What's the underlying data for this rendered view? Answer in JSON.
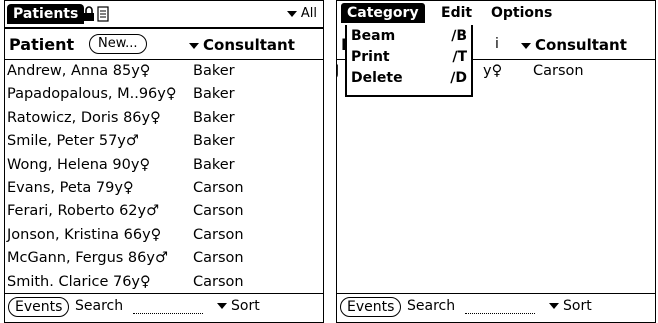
{
  "left": {
    "title": "Patients",
    "filter": "All",
    "patient_col": "Patient",
    "new_button": "New...",
    "consultant_col": "Consultant",
    "patients": [
      {
        "name": "Andrew, Anna 85y♀",
        "consultant": "Baker"
      },
      {
        "name": "Papadopalous, M..96y♀",
        "consultant": "Baker"
      },
      {
        "name": "Ratowicz, Doris 86y♀",
        "consultant": "Baker"
      },
      {
        "name": "Smile, Peter 57y♂",
        "consultant": "Baker"
      },
      {
        "name": "Wong, Helena 90y♀",
        "consultant": "Baker"
      },
      {
        "name": "Evans, Peta 79y♀",
        "consultant": "Carson"
      },
      {
        "name": "Ferari, Roberto 62y♂",
        "consultant": "Carson"
      },
      {
        "name": "Jonson, Kristina 66y♀",
        "consultant": "Carson"
      },
      {
        "name": "McGann, Fergus 86y♂",
        "consultant": "Carson"
      },
      {
        "name": "Smith. Clarice 76y♀",
        "consultant": "Carson"
      }
    ],
    "events_button": "Events",
    "search_label": "Search",
    "sort_label": "Sort"
  },
  "right": {
    "menus": [
      "Category",
      "Edit",
      "Options"
    ],
    "menu_items": [
      {
        "label": "Beam",
        "shortcut": "∕B"
      },
      {
        "label": "Print",
        "shortcut": "∕T"
      },
      {
        "label": "Delete",
        "shortcut": "∕D"
      }
    ],
    "header_fragment_left": "F",
    "header_fragment_mid": "i",
    "consultant_col": "Consultant",
    "visible_row": {
      "name_prefix": "J",
      "name_suffix": "y♀",
      "consultant": "Carson"
    },
    "events_button": "Events",
    "search_label": "Search",
    "sort_label": "Sort"
  }
}
